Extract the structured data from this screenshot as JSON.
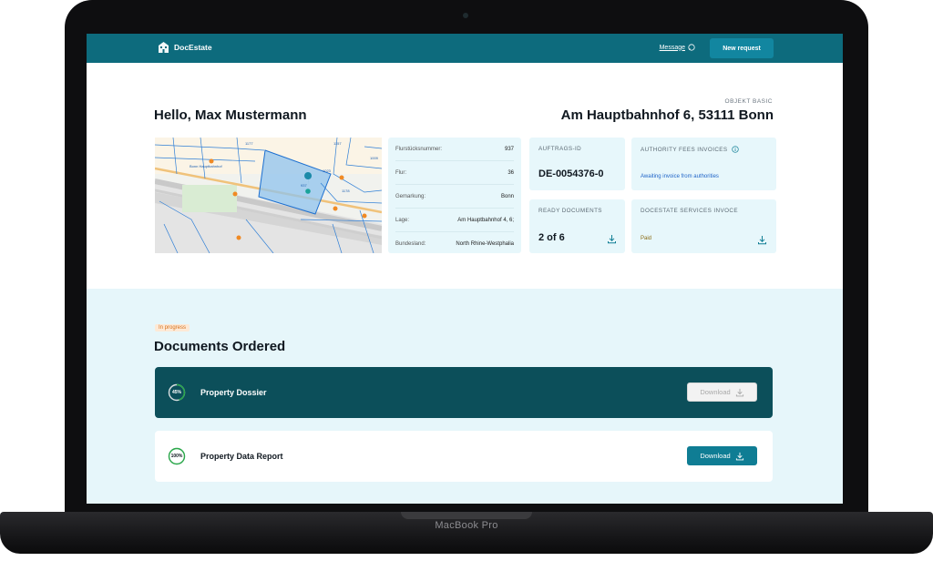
{
  "device": {
    "label": "MacBook Pro"
  },
  "header": {
    "brand": "DocEstate",
    "message_label": "Message",
    "new_request_label": "New request"
  },
  "greeting": "Hello, Max Mustermann",
  "object": {
    "label": "OBJEKT BASIC",
    "address": "Am Hauptbahnhof 6, 53111 Bonn"
  },
  "parcel": {
    "rows": [
      {
        "label": "Flurstücksnummer:",
        "value": "937"
      },
      {
        "label": "Flur:",
        "value": "36"
      },
      {
        "label": "Gemarkung:",
        "value": "Bonn"
      },
      {
        "label": "Lage:",
        "value": "Am Hauptbahnhof 4, 6;"
      },
      {
        "label": "Bundesland:",
        "value": "North Rhine-Westphalia"
      }
    ]
  },
  "order": {
    "label": "AUFTRAGS-ID",
    "value": "DE-0054376-0"
  },
  "ready": {
    "label": "READY DOCUMENTS",
    "value": "2 of 6"
  },
  "authority": {
    "label": "AUTHORITY FEES INVOICES",
    "status": "Awaiting invoice from authorities"
  },
  "services": {
    "label": "DOCESTATE SERVICES INVOCE",
    "status": "Paid"
  },
  "documents": {
    "badge": "In progress",
    "title": "Documents Ordered",
    "items": [
      {
        "name": "Property Dossier",
        "progress_label": "45%",
        "progress": 0.45,
        "button": "Download"
      },
      {
        "name": "Property Data Report",
        "progress_label": "100%",
        "progress": 1.0,
        "button": "Download"
      }
    ]
  },
  "map": {
    "labels": [
      "1177",
      "1157",
      "1009",
      "1023",
      "1178",
      "937",
      "Bonn Hauptbahnhof"
    ]
  },
  "colors": {
    "topbar": "#0d6b7d",
    "accent": "#0f7d94",
    "card": "#e7f7fb",
    "dark_row": "#0c4f5a",
    "progress_green": "#2aa84a"
  }
}
